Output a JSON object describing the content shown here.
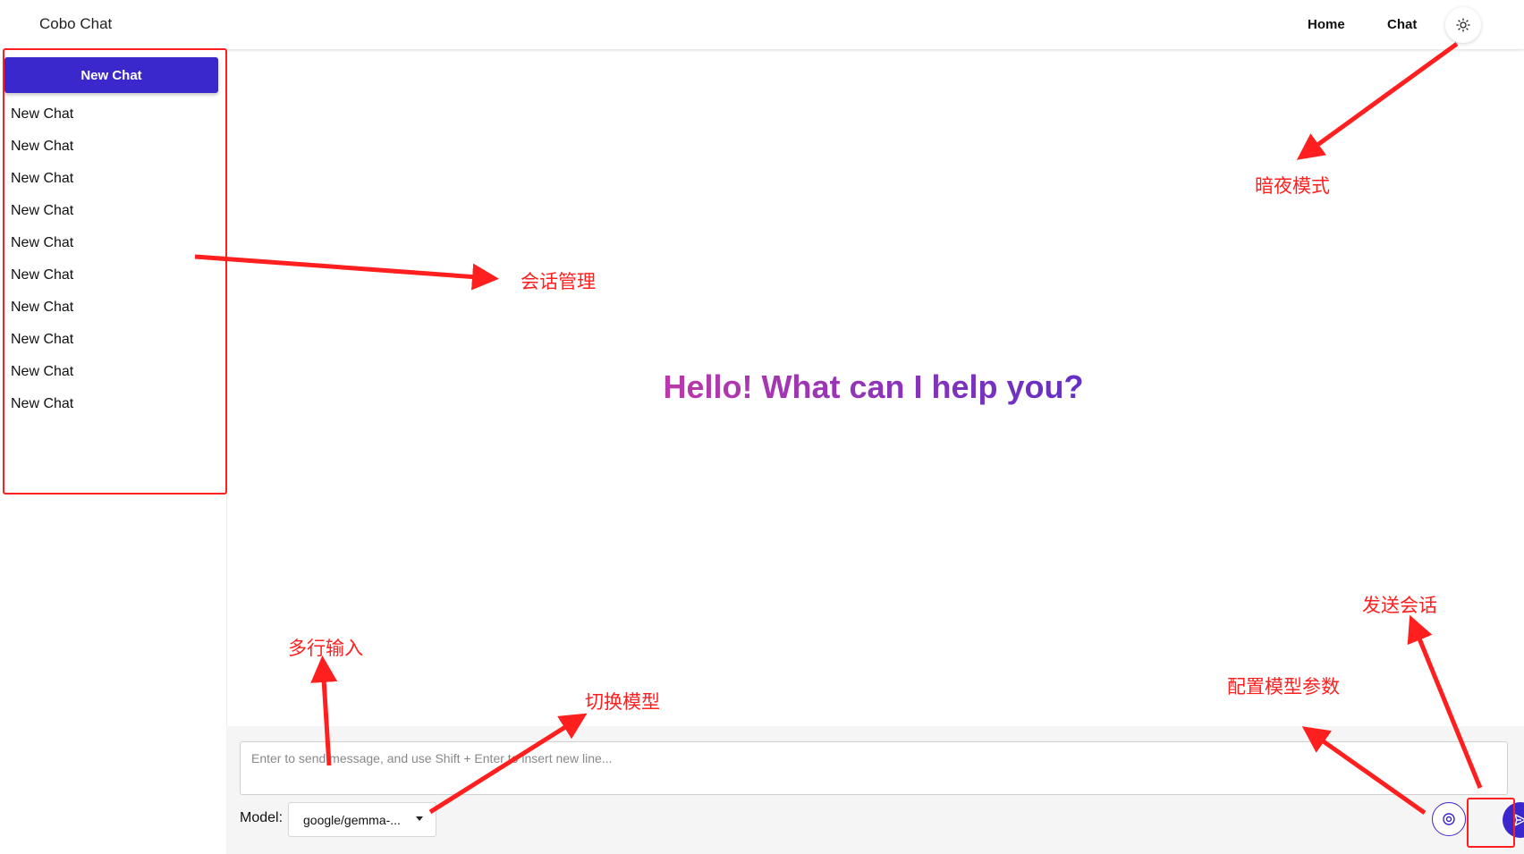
{
  "header": {
    "app_title": "Cobo Chat",
    "nav": [
      "Home",
      "Chat"
    ],
    "theme_icon": "sun-icon"
  },
  "sidebar": {
    "new_chat_label": "New Chat",
    "chats": [
      "New Chat",
      "New Chat",
      "New Chat",
      "New Chat",
      "New Chat",
      "New Chat",
      "New Chat",
      "New Chat",
      "New Chat",
      "New Chat"
    ]
  },
  "main": {
    "greeting": "Hello! What can I help you?",
    "gradient_colors": [
      "#c43aa8",
      "#5b2fc8"
    ]
  },
  "composer": {
    "placeholder": "Enter to send message, and use Shift + Enter to insert new line...",
    "model_label": "Model:",
    "model_selected": "google/gemma-...",
    "settings_icon": "settings-icon",
    "send_icon": "send-icon"
  },
  "annotations": {
    "dark_mode": "暗夜模式",
    "session_mgmt": "会话管理",
    "multiline_input": "多行输入",
    "switch_model": "切换模型",
    "config_params": "配置模型参数",
    "send_chat": "发送会话"
  },
  "colors": {
    "accent": "#3b28cc",
    "annotation": "#ff1f1f"
  }
}
